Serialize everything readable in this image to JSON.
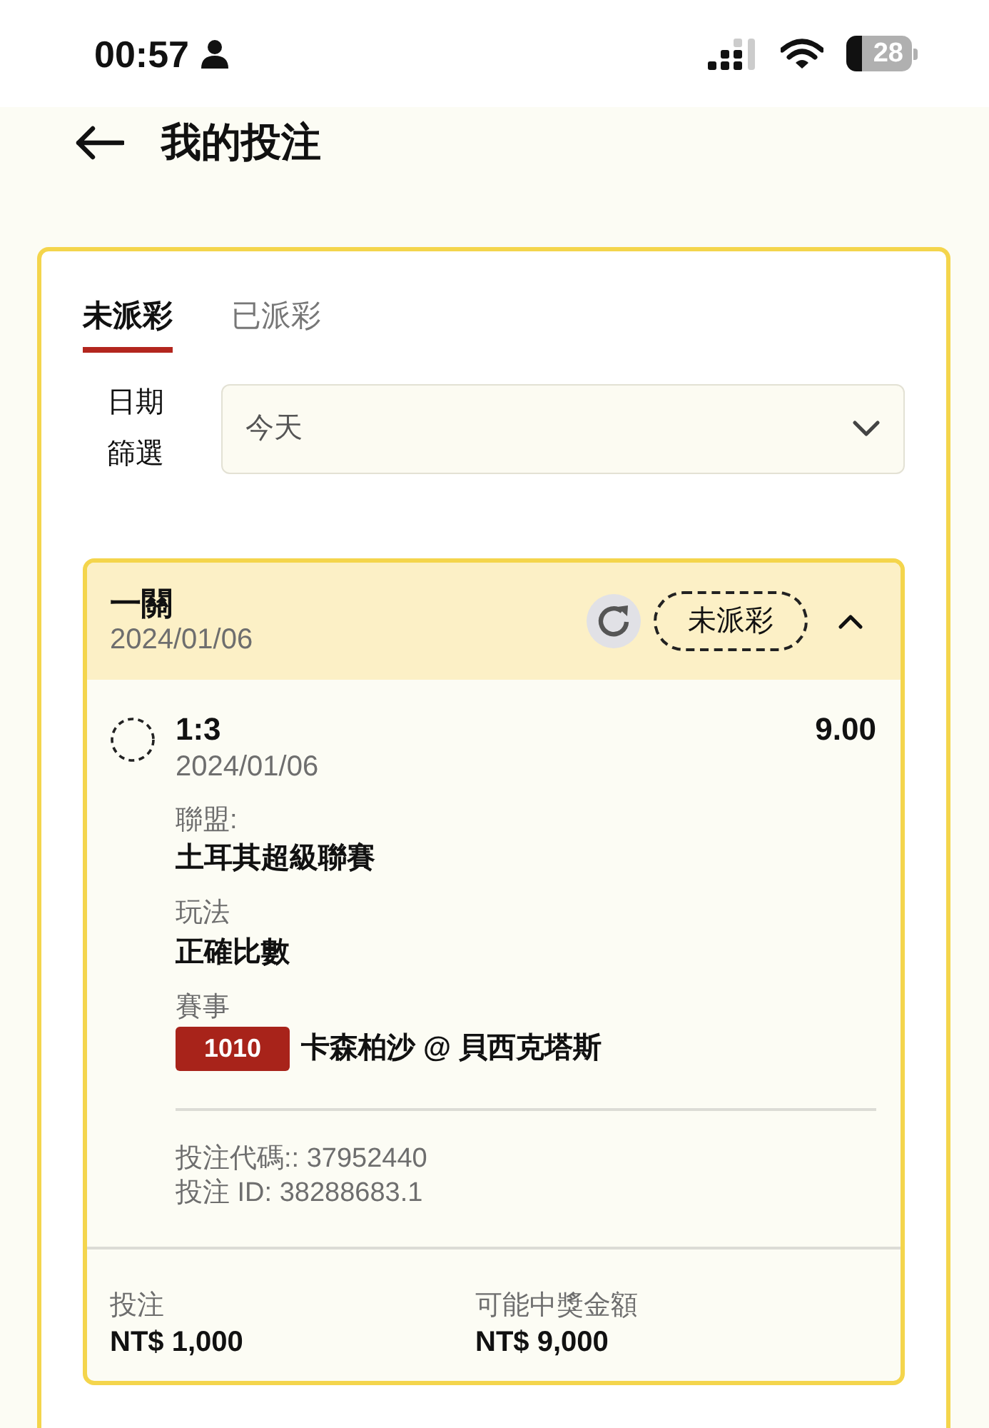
{
  "status_bar": {
    "time": "00:57",
    "battery": "28"
  },
  "header": {
    "title": "我的投注"
  },
  "tabs": [
    {
      "label": "未派彩",
      "selected": true
    },
    {
      "label": "已派彩",
      "selected": false
    }
  ],
  "date_filter": {
    "label": "日期篩選",
    "value": "今天"
  },
  "bet": {
    "type": "一關",
    "date": "2024/01/06",
    "status": "未派彩",
    "expanded": true,
    "selections": [
      {
        "score": "1:3",
        "odds": "9.00",
        "date": "2024/01/06",
        "fields": [
          {
            "label": "聯盟:",
            "value": "土耳其超級聯賽"
          },
          {
            "label": "玩法",
            "value": "正確比數"
          },
          {
            "label": "賽事",
            "match_code": "1010",
            "value": "卡森柏沙 @ 貝西克塔斯"
          }
        ],
        "bet_code": "投注代碼:: 37952440",
        "bet_id": "投注 ID: 38288683.1"
      }
    ],
    "stake_label": "投注",
    "stake": "NT$ 1,000",
    "payout_label": "可能中獎金額",
    "payout": "NT$ 9,000"
  }
}
